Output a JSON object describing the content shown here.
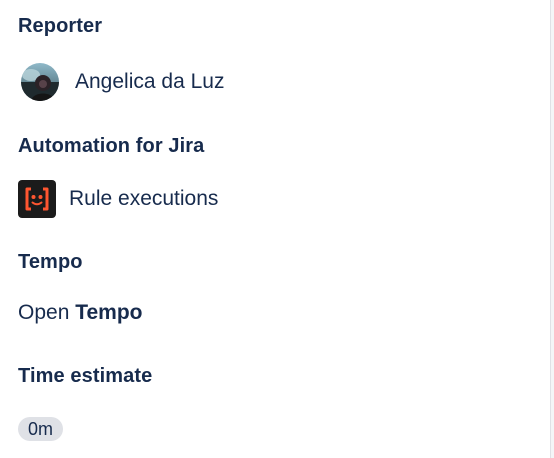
{
  "reporter": {
    "heading": "Reporter",
    "name": "Angelica da Luz"
  },
  "automation": {
    "heading": "Automation for Jira",
    "link_label": "Rule executions",
    "icon": "automation-brackets-icon",
    "icon_color": "#ff5630"
  },
  "tempo": {
    "heading": "Tempo",
    "open_prefix": "Open",
    "open_app": "Tempo"
  },
  "time_estimate": {
    "heading": "Time estimate",
    "value": "0m"
  }
}
